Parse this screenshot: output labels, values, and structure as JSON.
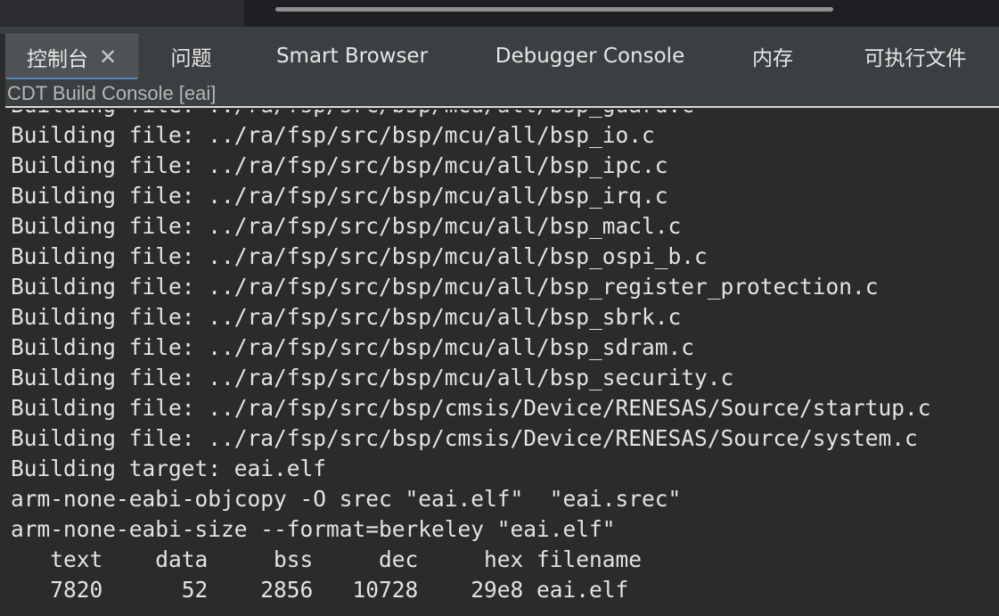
{
  "tabs": [
    {
      "label": "控制台",
      "active": true,
      "closable": true
    },
    {
      "label": "问题"
    },
    {
      "label": "Smart Browser"
    },
    {
      "label": "Debugger Console"
    },
    {
      "label": "内存"
    },
    {
      "label": "可执行文件"
    }
  ],
  "console": {
    "title": "CDT Build Console [eai]",
    "lines": [
      "Building file: ../ra/fsp/src/bsp/mcu/all/bsp_guard.c",
      "Building file: ../ra/fsp/src/bsp/mcu/all/bsp_io.c",
      "Building file: ../ra/fsp/src/bsp/mcu/all/bsp_ipc.c",
      "Building file: ../ra/fsp/src/bsp/mcu/all/bsp_irq.c",
      "Building file: ../ra/fsp/src/bsp/mcu/all/bsp_macl.c",
      "Building file: ../ra/fsp/src/bsp/mcu/all/bsp_ospi_b.c",
      "Building file: ../ra/fsp/src/bsp/mcu/all/bsp_register_protection.c",
      "Building file: ../ra/fsp/src/bsp/mcu/all/bsp_sbrk.c",
      "Building file: ../ra/fsp/src/bsp/mcu/all/bsp_sdram.c",
      "Building file: ../ra/fsp/src/bsp/mcu/all/bsp_security.c",
      "Building file: ../ra/fsp/src/bsp/cmsis/Device/RENESAS/Source/startup.c",
      "Building file: ../ra/fsp/src/bsp/cmsis/Device/RENESAS/Source/system.c",
      "Building target: eai.elf",
      "arm-none-eabi-objcopy -O srec \"eai.elf\"  \"eai.srec\"",
      "arm-none-eabi-size --format=berkeley \"eai.elf\"",
      "   text    data     bss     dec     hex filename",
      "   7820      52    2856   10728    29e8 eai.elf"
    ]
  },
  "colors": {
    "background": "#2b2b2b",
    "tab_bar": "#3c3f41",
    "active_tab": "#4e5254",
    "accent": "#4a88c7",
    "text": "#e3e3e3"
  }
}
